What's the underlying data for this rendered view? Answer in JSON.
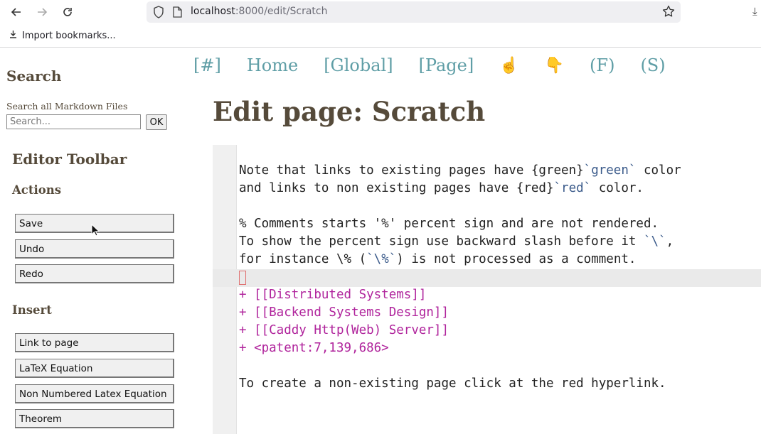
{
  "browser": {
    "url_host": "localhost",
    "url_rest": ":8000/edit/Scratch",
    "bookmarks_item": "Import bookmarks..."
  },
  "nav": {
    "items": [
      "[#]",
      "Home",
      "[Global]",
      "[Page]",
      "☝",
      "👇",
      "(F)",
      "(S)"
    ]
  },
  "sidebar": {
    "search_heading": "Search",
    "search_label": "Search all Markdown Files",
    "search_placeholder": "Search...",
    "ok_label": "OK",
    "toolbar_heading": "Editor Toolbar",
    "actions_heading": "Actions",
    "actions": [
      "Save",
      "Undo",
      "Redo"
    ],
    "insert_heading": "Insert",
    "insert": [
      "Link to page",
      "LaTeX Equation",
      "Non Numbered Latex Equation",
      "Theorem"
    ]
  },
  "main": {
    "title": "Edit page: Scratch"
  },
  "editor": {
    "l1a": "Note that links to existing pages have {green}",
    "l1b": "`green`",
    "l1c": " color",
    "l2a": "and links to non existing pages have {red}",
    "l2b": "`red`",
    "l2c": " color.",
    "l3": "% Comments starts '%' percent sign and are not rendered.",
    "l4a": "To show the percent sign use backward slash before it ",
    "l4b": "`\\`",
    "l4c": ",",
    "l5a": "for instance \\% (",
    "l5b": "`\\%`",
    "l5c": ") is not processed as a comment.",
    "list": [
      "+ [[Distributed Systems]]",
      "+ [[Backend Systems Design]]",
      "+ [[Caddy Http(Web) Server]]",
      "+ <patent:7,139,686>"
    ],
    "last": "To create a non-existing page click at the red hyperlink."
  },
  "colors": {
    "heading": "#554a3a",
    "nav_link": "#5f9ea6",
    "list_magenta": "#b0249c",
    "inline_code": "#3a5a8a"
  }
}
